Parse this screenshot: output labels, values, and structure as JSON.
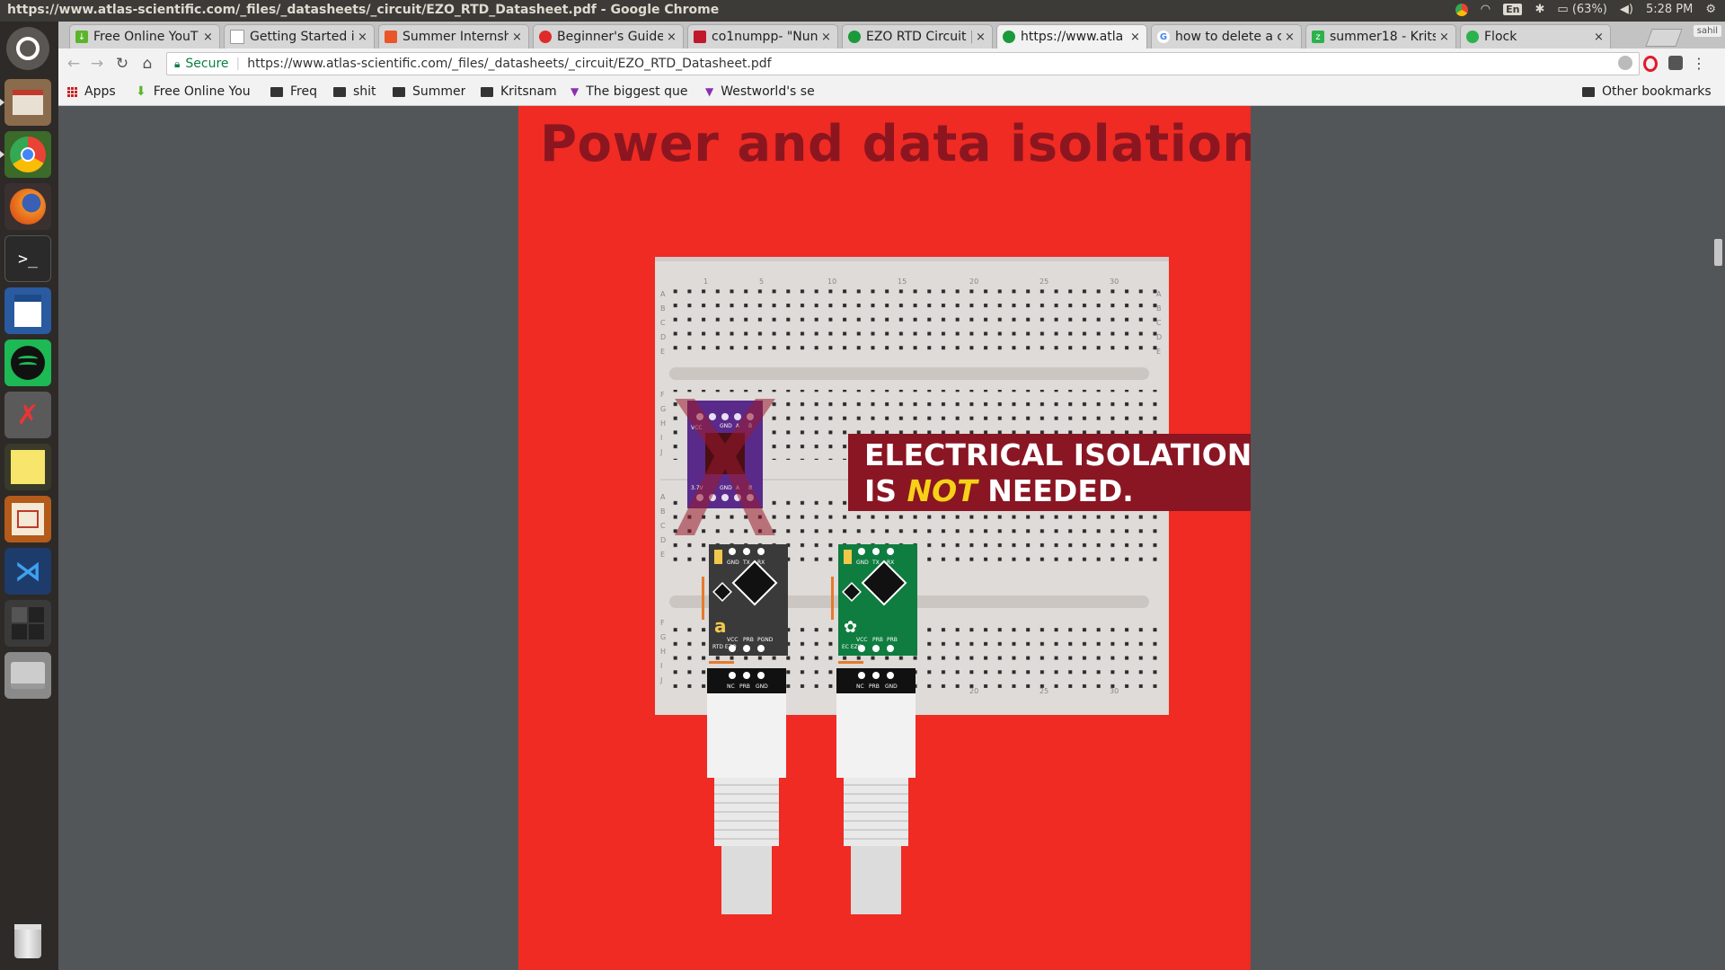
{
  "window_title": "https://www.atlas-scientific.com/_files/_datasheets/_circuit/EZO_RTD_Datasheet.pdf - Google Chrome",
  "indicators": {
    "battery": "(63%)",
    "time": "5:28 PM",
    "keyboard": "En",
    "user": "sahil"
  },
  "launcher": [
    "dash-home",
    "files",
    "chrome",
    "firefox",
    "terminal",
    "writer",
    "spotify",
    "settings",
    "sticky-notes",
    "circuit-app",
    "vscode",
    "workspaces",
    "drive",
    "trash"
  ],
  "tabs": [
    {
      "title": "Free Online YouT",
      "favicon_color": "#5ab52a"
    },
    {
      "title": "Getting Started i",
      "favicon_color": "#bbbbbb"
    },
    {
      "title": "Summer Internsh",
      "favicon_color": "#e8562a"
    },
    {
      "title": "Beginner's Guide",
      "favicon_color": "#e02a2a"
    },
    {
      "title": "co1numpp- \"Nun",
      "favicon_color": "#c0182c"
    },
    {
      "title": "EZO RTD Circuit |",
      "favicon_color": "#1a9a3a"
    },
    {
      "title": "https://www.atla",
      "favicon_color": "#1a9a3a"
    },
    {
      "title": "how to delete a c",
      "favicon_color": "#4285f4"
    },
    {
      "title": "summer18 - Krits",
      "favicon_color": "#2bb24c"
    },
    {
      "title": "Flock",
      "favicon_color": "#2bb24c"
    }
  ],
  "omnibox": {
    "secure_label": "Secure",
    "url": "https://www.atlas-scientific.com/_files/_datasheets/_circuit/EZO_RTD_Datasheet.pdf"
  },
  "bookmarks": [
    {
      "label": "Apps",
      "icon": "apps-icon"
    },
    {
      "label": "Free Online You",
      "icon": "download-icon"
    },
    {
      "label": "Freq",
      "icon": "folder-icon"
    },
    {
      "label": "shit",
      "icon": "folder-icon"
    },
    {
      "label": "Summer",
      "icon": "folder-icon"
    },
    {
      "label": "Kritsnam",
      "icon": "folder-icon"
    },
    {
      "label": "The biggest que",
      "icon": "triangle-icon"
    },
    {
      "label": "Westworld's se",
      "icon": "triangle-icon"
    }
  ],
  "other_bookmarks": "Other bookmarks",
  "pdf": {
    "heading": "Power and data isolation",
    "callout_line1": "ELECTRICAL ISOLATION",
    "callout_is": "IS ",
    "callout_not": "NOT",
    "callout_needed": " NEEDED.",
    "breadboard_cols": [
      "1",
      "5",
      "10",
      "15",
      "20",
      "25",
      "30"
    ],
    "breadboard_rows_top": [
      "A",
      "B",
      "C",
      "D",
      "E"
    ],
    "breadboard_rows_bottom": [
      "F",
      "G",
      "H",
      "I",
      "J"
    ],
    "isolator_pins_top": [
      "VCC",
      "GND",
      "A",
      "B"
    ],
    "isolator_pins_bottom": [
      "3.7V",
      "GND",
      "A",
      "B"
    ],
    "rtd_pins_top": [
      "GND",
      "TX",
      "RX"
    ],
    "rtd_pins_bottom": [
      "VCC",
      "PRB",
      "PGND"
    ],
    "rtd_label": "RTD EZO",
    "ec_label": "EC EZO",
    "ec_pins_bottom": [
      "VCC",
      "PRB",
      "PRB"
    ],
    "bnc_pins": [
      "NC",
      "PRB",
      "GND"
    ],
    "colors": {
      "page": "#ef2b23",
      "heading": "#8b1620",
      "callout_bg": "#8a1523",
      "callout_highlight": "#f7d117",
      "rtd_board": "#3a3a3a",
      "ec_board": "#0f7d3f",
      "isolator_board": "#5a2a8a"
    }
  }
}
